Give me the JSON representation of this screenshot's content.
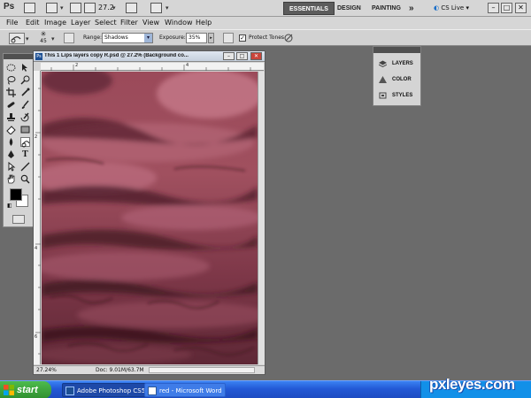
{
  "app": {
    "logo": "Ps",
    "zoom_value": "27.2",
    "workspaces": [
      "ESSENTIALS",
      "DESIGN",
      "PAINTING"
    ],
    "more": "»",
    "cs_live": "CS Live",
    "minimize": "–",
    "restore": "□",
    "close": "✕"
  },
  "menu": [
    "File",
    "Edit",
    "Image",
    "Layer",
    "Select",
    "Filter",
    "View",
    "Window",
    "Help"
  ],
  "options": {
    "brush_size": "45",
    "range_label": "Range:",
    "range_value": "Shadows",
    "exposure_label": "Exposure:",
    "exposure_value": "35%",
    "protect_tones_label": "Protect Tones",
    "protect_tones_checked": true
  },
  "tools": [
    "marquee",
    "move",
    "lasso",
    "quick-select",
    "crop",
    "eyedropper",
    "healing",
    "brush",
    "clone-stamp",
    "history-brush",
    "eraser",
    "gradient",
    "burn",
    "dodge",
    "pen",
    "type",
    "path-select",
    "shape",
    "hand",
    "zoom"
  ],
  "colors": {
    "foreground": "#000000",
    "background": "#ffffff",
    "accent": "#c43848"
  },
  "document": {
    "title": "This 1 Lips layers copy R.psd @ 27.2% (Background co...",
    "ruler_top": [
      "2",
      "4"
    ],
    "ruler_left": [
      "2",
      "4",
      "6"
    ],
    "zoom_status": "27.24%",
    "doc_info": "Doc: 9.01M/63.7M"
  },
  "panels": [
    "LAYERS",
    "COLOR",
    "STYLES"
  ],
  "taskbar": {
    "start": "start",
    "tasks": [
      "Adobe Photoshop CS5",
      "red - Microsoft Word"
    ]
  },
  "watermark": {
    "brand": "pxleyes",
    "tld": ".com"
  }
}
